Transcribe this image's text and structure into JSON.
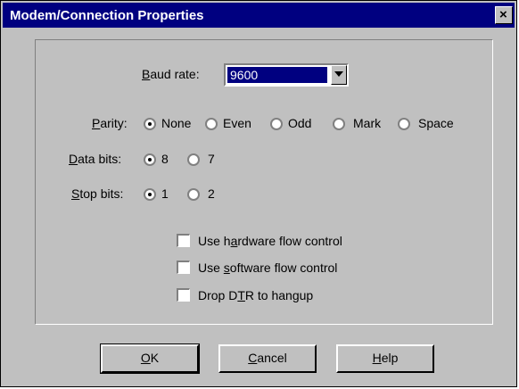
{
  "window": {
    "title": "Modem/Connection Properties",
    "close_glyph": "×"
  },
  "baud": {
    "label_pre": "",
    "label_key": "B",
    "label_post": "aud rate:",
    "value": "9600"
  },
  "parity": {
    "label_key": "P",
    "label_post": "arity:",
    "options": [
      "None",
      "Even",
      "Odd",
      "Mark",
      "Space"
    ],
    "selected": "None"
  },
  "data_bits": {
    "label_key": "D",
    "label_post": "ata bits:",
    "options": [
      "8",
      "7"
    ],
    "selected": "8"
  },
  "stop_bits": {
    "label_key": "S",
    "label_post": "top bits:",
    "options": [
      "1",
      "2"
    ],
    "selected": "1"
  },
  "checkboxes": [
    {
      "pre": "Use h",
      "key": "a",
      "post": "rdware flow control",
      "checked": false
    },
    {
      "pre": "Use ",
      "key": "s",
      "post": "oftware flow control",
      "checked": false
    },
    {
      "pre": "Drop D",
      "key": "T",
      "post": "R to hangup",
      "checked": false
    }
  ],
  "buttons": {
    "ok_key": "O",
    "ok_post": "K",
    "cancel_key": "C",
    "cancel_post": "ancel",
    "help_key": "H",
    "help_post": "elp"
  }
}
